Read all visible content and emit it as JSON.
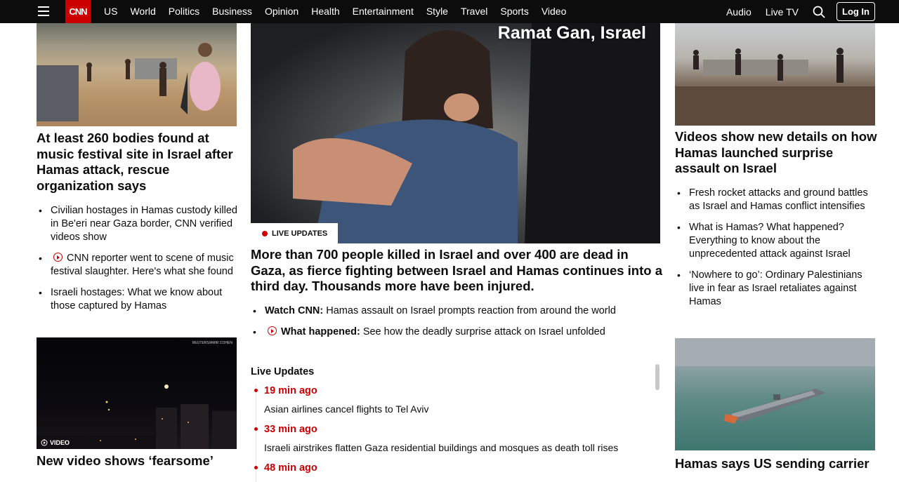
{
  "nav": {
    "links": [
      "US",
      "World",
      "Politics",
      "Business",
      "Opinion",
      "Health",
      "Entertainment",
      "Style",
      "Travel",
      "Sports",
      "Video"
    ],
    "audio": "Audio",
    "live_tv": "Live TV",
    "login": "Log In",
    "logo": "CNN"
  },
  "left": {
    "headline1": "At least 260 bodies found at music festival site in Israel after Hamas attack, rescue organization says",
    "bullets": [
      "Civilian hostages in Hamas custody killed in Be'eri near Gaza border, CNN verified videos show",
      "CNN reporter went to scene of music festival slaughter. Here's what she found",
      "Israeli hostages: What we know about those captured by Hamas"
    ],
    "video_badge": "VIDEO",
    "reuters_credit": "REUTERS/AMIR COHEN",
    "headline2": "New video shows ‘fearsome’"
  },
  "main": {
    "dateline": "Ramat Gan, Israel",
    "live_badge": "LIVE UPDATES",
    "headline": "More than 700 people killed in Israel and over 400 are dead in Gaza, as fierce fighting between Israel and Hamas continues into a third day. Thousands more have been injured.",
    "bullets": [
      {
        "label": "Watch CNN:",
        "text": "Hamas assault on Israel prompts reaction from around the world"
      },
      {
        "label": "What happened:",
        "text": "See how the deadly surprise attack on Israel unfolded"
      }
    ],
    "live_updates_title": "Live Updates",
    "updates": [
      {
        "time": "19 min ago",
        "text": "Asian airlines cancel flights to Tel Aviv"
      },
      {
        "time": "33 min ago",
        "text": "Israeli airstrikes flatten Gaza residential buildings and mosques as death toll rises"
      },
      {
        "time": "48 min ago",
        "text": ""
      }
    ]
  },
  "right": {
    "headline1": "Videos show new details on how Hamas launched surprise assault on Israel",
    "bullets": [
      "Fresh rocket attacks and ground battles as Israel and Hamas conflict intensifies",
      "What is Hamas? What happened? Everything to know about the unprecedented attack against Israel",
      "‘Nowhere to go’: Ordinary Palestinians live in fear as Israel retaliates against Hamas"
    ],
    "headline2": "Hamas says US sending carrier"
  },
  "colors": {
    "brand_red": "#cc0000",
    "nav_bg": "#0c0c0c"
  }
}
